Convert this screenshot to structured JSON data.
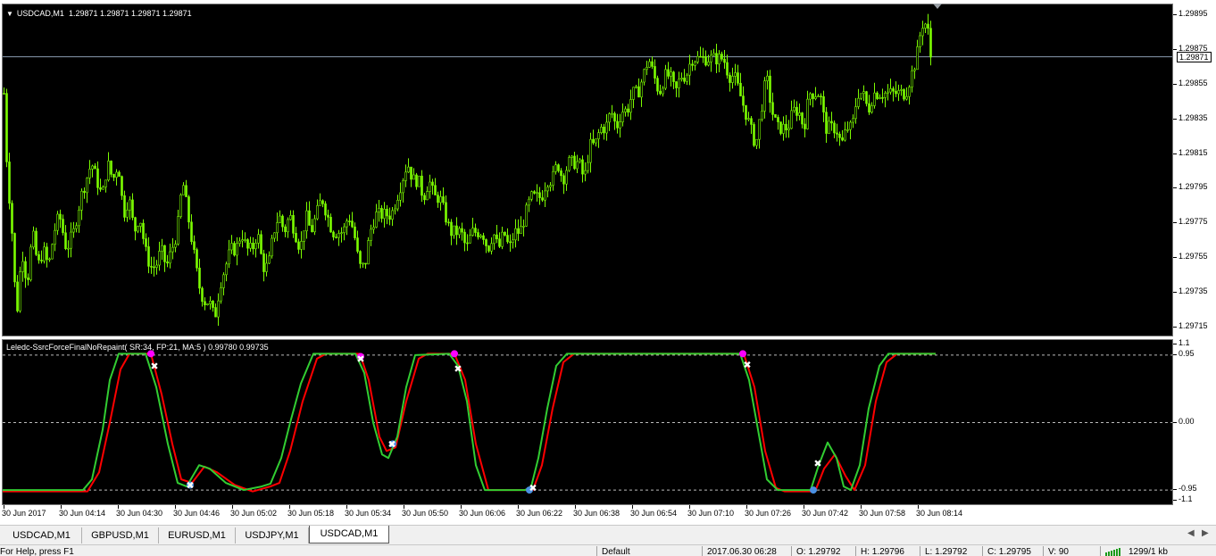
{
  "chart": {
    "symbol_label": "USDCAD,M1",
    "ohlc_text": "1.29871 1.29871 1.29871 1.29871",
    "current_price": "1.29871",
    "price_scale": [
      "1.29895",
      "1.29875",
      "1.29855",
      "1.29835",
      "1.29815",
      "1.29795",
      "1.29775",
      "1.29755",
      "1.29735",
      "1.29715"
    ],
    "candle_color": "#7cfc00",
    "background": "#000000"
  },
  "indicator": {
    "label": "Leledc-SsrcForceFinalNoRepaint( SR:34, FP:21, MA:5 ) 0.99780 0.99735",
    "scale": [
      "1.1",
      "0.95",
      "0.00",
      "-0.95",
      "-1.1"
    ],
    "fast_color": "#32cd32",
    "slow_color": "#ff0000",
    "sell_marker_color": "#ff00ff",
    "buy_marker_color": "#4a90e2"
  },
  "time_axis": [
    "30 Jun 2017",
    "30 Jun 04:14",
    "30 Jun 04:30",
    "30 Jun 04:46",
    "30 Jun 05:02",
    "30 Jun 05:18",
    "30 Jun 05:34",
    "30 Jun 05:50",
    "30 Jun 06:06",
    "30 Jun 06:22",
    "30 Jun 06:38",
    "30 Jun 06:54",
    "30 Jun 07:10",
    "30 Jun 07:26",
    "30 Jun 07:42",
    "30 Jun 07:58",
    "30 Jun 08:14"
  ],
  "tabs": [
    "USDCAD,M1",
    "GBPUSD,M1",
    "EURUSD,M1",
    "USDJPY,M1",
    "USDCAD,M1"
  ],
  "active_tab_index": 4,
  "status": {
    "help": "For Help, press F1",
    "profile": "Default",
    "datetime": "2017.06.30 06:28",
    "open": "O: 1.29792",
    "high": "H: 1.29796",
    "low": "L: 1.29792",
    "close": "C: 1.29795",
    "volume": "V: 90",
    "traffic": "1299/1 kb"
  },
  "series": {
    "close_path": [
      [
        0,
        1.2985
      ],
      [
        4,
        1.298
      ],
      [
        8,
        1.2978
      ],
      [
        14,
        1.2972
      ],
      [
        20,
        1.2976
      ],
      [
        26,
        1.2974
      ],
      [
        32,
        1.2977
      ],
      [
        38,
        1.2975
      ],
      [
        44,
        1.2976
      ],
      [
        50,
        1.2975
      ],
      [
        56,
        1.2977
      ],
      [
        62,
        1.2978
      ],
      [
        70,
        1.2976
      ],
      [
        78,
        1.2977
      ],
      [
        86,
        1.2979
      ],
      [
        92,
        1.298
      ],
      [
        98,
        1.2981
      ],
      [
        104,
        1.298
      ],
      [
        110,
        1.2979
      ],
      [
        116,
        1.2981
      ],
      [
        122,
        1.298
      ],
      [
        128,
        1.2981
      ],
      [
        134,
        1.2978
      ],
      [
        140,
        1.2979
      ],
      [
        146,
        1.2977
      ],
      [
        152,
        1.2978
      ],
      [
        158,
        1.2976
      ],
      [
        164,
        1.2975
      ],
      [
        170,
        1.2975
      ],
      [
        176,
        1.2976
      ],
      [
        182,
        1.2975
      ],
      [
        188,
        1.2976
      ],
      [
        194,
        1.2977
      ],
      [
        200,
        1.298
      ],
      [
        206,
        1.2978
      ],
      [
        212,
        1.2976
      ],
      [
        218,
        1.2974
      ],
      [
        224,
        1.2973
      ],
      [
        230,
        1.2973
      ],
      [
        236,
        1.2972
      ],
      [
        242,
        1.2974
      ],
      [
        248,
        1.2975
      ],
      [
        254,
        1.2976
      ],
      [
        260,
        1.2976
      ],
      [
        266,
        1.2977
      ],
      [
        272,
        1.2976
      ],
      [
        278,
        1.2976
      ],
      [
        284,
        1.2977
      ],
      [
        290,
        1.2975
      ],
      [
        296,
        1.2975
      ],
      [
        302,
        1.2977
      ],
      [
        308,
        1.2978
      ],
      [
        314,
        1.2977
      ],
      [
        320,
        1.2978
      ],
      [
        326,
        1.2977
      ],
      [
        332,
        1.2976
      ],
      [
        338,
        1.2978
      ],
      [
        344,
        1.2977
      ],
      [
        350,
        1.2978
      ],
      [
        356,
        1.2979
      ],
      [
        362,
        1.2978
      ],
      [
        368,
        1.2977
      ],
      [
        374,
        1.2977
      ],
      [
        380,
        1.2977
      ],
      [
        386,
        1.2978
      ],
      [
        392,
        1.2977
      ],
      [
        398,
        1.2975
      ],
      [
        404,
        1.2975
      ],
      [
        410,
        1.2977
      ],
      [
        416,
        1.2978
      ],
      [
        422,
        1.2978
      ],
      [
        428,
        1.2978
      ],
      [
        434,
        1.2978
      ],
      [
        440,
        1.2979
      ],
      [
        446,
        1.298
      ],
      [
        452,
        1.2981
      ],
      [
        458,
        1.298
      ],
      [
        464,
        1.298
      ],
      [
        470,
        1.2979
      ],
      [
        476,
        1.298
      ],
      [
        482,
        1.2979
      ],
      [
        488,
        1.2979
      ],
      [
        494,
        1.2978
      ],
      [
        500,
        1.2977
      ],
      [
        506,
        1.2977
      ],
      [
        512,
        1.2977
      ],
      [
        518,
        1.2976
      ],
      [
        524,
        1.2977
      ],
      [
        530,
        1.2977
      ],
      [
        536,
        1.2977
      ],
      [
        542,
        1.2976
      ],
      [
        548,
        1.2977
      ],
      [
        554,
        1.2976
      ],
      [
        560,
        1.2977
      ],
      [
        566,
        1.2976
      ],
      [
        572,
        1.2977
      ],
      [
        578,
        1.2977
      ],
      [
        584,
        1.2978
      ],
      [
        590,
        1.2979
      ],
      [
        596,
        1.2979
      ],
      [
        602,
        1.2979
      ],
      [
        608,
        1.298
      ],
      [
        614,
        1.298
      ],
      [
        620,
        1.2981
      ],
      [
        626,
        1.298
      ],
      [
        632,
        1.2981
      ],
      [
        638,
        1.2981
      ],
      [
        644,
        1.2981
      ],
      [
        650,
        1.298
      ],
      [
        656,
        1.2982
      ],
      [
        662,
        1.2982
      ],
      [
        668,
        1.2983
      ],
      [
        674,
        1.2983
      ],
      [
        680,
        1.2984
      ],
      [
        686,
        1.2983
      ],
      [
        692,
        1.2984
      ],
      [
        698,
        1.2984
      ],
      [
        704,
        1.2985
      ],
      [
        710,
        1.2985
      ],
      [
        716,
        1.2986
      ],
      [
        722,
        1.2987
      ],
      [
        728,
        1.2986
      ],
      [
        734,
        1.2985
      ],
      [
        740,
        1.2986
      ],
      [
        746,
        1.2986
      ],
      [
        752,
        1.2985
      ],
      [
        758,
        1.2986
      ],
      [
        764,
        1.2986
      ],
      [
        770,
        1.2987
      ],
      [
        776,
        1.2987
      ],
      [
        782,
        1.2987
      ],
      [
        788,
        1.2987
      ],
      [
        794,
        1.2987
      ],
      [
        800,
        1.2987
      ],
      [
        806,
        1.2987
      ],
      [
        812,
        1.2986
      ],
      [
        818,
        1.2986
      ],
      [
        824,
        1.2985
      ],
      [
        830,
        1.2984
      ],
      [
        836,
        1.2983
      ],
      [
        842,
        1.2982
      ],
      [
        848,
        1.2984
      ],
      [
        854,
        1.2986
      ],
      [
        860,
        1.2984
      ],
      [
        866,
        1.2983
      ],
      [
        872,
        1.2983
      ],
      [
        878,
        1.2983
      ],
      [
        884,
        1.2984
      ],
      [
        890,
        1.2984
      ],
      [
        896,
        1.2983
      ],
      [
        902,
        1.2985
      ],
      [
        908,
        1.2985
      ],
      [
        914,
        1.2985
      ],
      [
        920,
        1.2983
      ],
      [
        926,
        1.2983
      ],
      [
        932,
        1.2983
      ],
      [
        938,
        1.2982
      ],
      [
        944,
        1.2983
      ],
      [
        950,
        1.2983
      ],
      [
        956,
        1.2985
      ],
      [
        962,
        1.2985
      ],
      [
        968,
        1.2984
      ],
      [
        974,
        1.2985
      ],
      [
        980,
        1.2985
      ],
      [
        986,
        1.2985
      ],
      [
        992,
        1.2985
      ],
      [
        998,
        1.2985
      ],
      [
        1004,
        1.2985
      ],
      [
        1010,
        1.2985
      ],
      [
        1016,
        1.2986
      ],
      [
        1022,
        1.2987
      ],
      [
        1028,
        1.2989
      ],
      [
        1034,
        1.2989
      ],
      [
        1038,
        1.29871
      ]
    ],
    "fast_path": [
      [
        0,
        -0.95
      ],
      [
        90,
        -0.95
      ],
      [
        100,
        -0.8
      ],
      [
        112,
        -0.1
      ],
      [
        120,
        0.6
      ],
      [
        130,
        0.97
      ],
      [
        160,
        0.97
      ],
      [
        172,
        0.5
      ],
      [
        185,
        -0.3
      ],
      [
        196,
        -0.85
      ],
      [
        206,
        -0.9
      ],
      [
        220,
        -0.6
      ],
      [
        232,
        -0.65
      ],
      [
        250,
        -0.85
      ],
      [
        270,
        -0.95
      ],
      [
        290,
        -0.9
      ],
      [
        300,
        -0.86
      ],
      [
        312,
        -0.5
      ],
      [
        322,
        0.0
      ],
      [
        334,
        0.55
      ],
      [
        348,
        0.97
      ],
      [
        395,
        0.97
      ],
      [
        405,
        0.7
      ],
      [
        415,
        0.0
      ],
      [
        425,
        -0.45
      ],
      [
        432,
        -0.5
      ],
      [
        442,
        -0.2
      ],
      [
        452,
        0.5
      ],
      [
        462,
        0.95
      ],
      [
        500,
        0.97
      ],
      [
        510,
        0.8
      ],
      [
        520,
        0.3
      ],
      [
        530,
        -0.6
      ],
      [
        540,
        -0.95
      ],
      [
        585,
        -0.95
      ],
      [
        592,
        -0.9
      ],
      [
        600,
        -0.5
      ],
      [
        610,
        0.2
      ],
      [
        620,
        0.8
      ],
      [
        632,
        0.97
      ],
      [
        826,
        0.97
      ],
      [
        836,
        0.6
      ],
      [
        846,
        -0.1
      ],
      [
        856,
        -0.8
      ],
      [
        868,
        -0.95
      ],
      [
        905,
        -0.95
      ],
      [
        914,
        -0.6
      ],
      [
        924,
        -0.28
      ],
      [
        934,
        -0.5
      ],
      [
        942,
        -0.9
      ],
      [
        950,
        -0.95
      ],
      [
        960,
        -0.6
      ],
      [
        970,
        0.2
      ],
      [
        982,
        0.8
      ],
      [
        992,
        0.97
      ],
      [
        1045,
        0.97
      ]
    ],
    "slow_path": [
      [
        0,
        -0.97
      ],
      [
        95,
        -0.97
      ],
      [
        108,
        -0.7
      ],
      [
        120,
        0.0
      ],
      [
        132,
        0.75
      ],
      [
        142,
        0.97
      ],
      [
        166,
        0.97
      ],
      [
        178,
        0.4
      ],
      [
        190,
        -0.3
      ],
      [
        200,
        -0.8
      ],
      [
        212,
        -0.85
      ],
      [
        226,
        -0.62
      ],
      [
        240,
        -0.7
      ],
      [
        260,
        -0.88
      ],
      [
        280,
        -0.97
      ],
      [
        300,
        -0.9
      ],
      [
        310,
        -0.85
      ],
      [
        322,
        -0.4
      ],
      [
        336,
        0.3
      ],
      [
        352,
        0.9
      ],
      [
        362,
        0.97
      ],
      [
        400,
        0.97
      ],
      [
        410,
        0.6
      ],
      [
        422,
        -0.2
      ],
      [
        430,
        -0.4
      ],
      [
        440,
        -0.35
      ],
      [
        452,
        0.3
      ],
      [
        466,
        0.9
      ],
      [
        476,
        0.97
      ],
      [
        506,
        0.97
      ],
      [
        518,
        0.6
      ],
      [
        530,
        -0.3
      ],
      [
        544,
        -0.95
      ],
      [
        594,
        -0.95
      ],
      [
        604,
        -0.6
      ],
      [
        616,
        0.2
      ],
      [
        628,
        0.85
      ],
      [
        640,
        0.97
      ],
      [
        830,
        0.97
      ],
      [
        842,
        0.5
      ],
      [
        854,
        -0.4
      ],
      [
        866,
        -0.92
      ],
      [
        876,
        -0.97
      ],
      [
        910,
        -0.97
      ],
      [
        920,
        -0.65
      ],
      [
        932,
        -0.45
      ],
      [
        944,
        -0.75
      ],
      [
        954,
        -0.95
      ],
      [
        966,
        -0.6
      ],
      [
        978,
        0.3
      ],
      [
        990,
        0.85
      ],
      [
        1002,
        0.97
      ],
      [
        1045,
        0.97
      ]
    ],
    "sell_points": [
      [
        166,
        0.97
      ],
      [
        401,
        0.93
      ],
      [
        506,
        0.97
      ],
      [
        829,
        0.97
      ]
    ],
    "buy_points": [
      [
        210,
        -0.88
      ],
      [
        437,
        -0.3
      ],
      [
        590,
        -0.95
      ],
      [
        908,
        -0.95
      ]
    ],
    "x_marks": [
      [
        170,
        0.8
      ],
      [
        401,
        0.9
      ],
      [
        510,
        0.76
      ],
      [
        594,
        -0.92
      ],
      [
        436,
        -0.3
      ],
      [
        210,
        -0.88
      ],
      [
        834,
        0.82
      ],
      [
        913,
        -0.57
      ]
    ]
  }
}
